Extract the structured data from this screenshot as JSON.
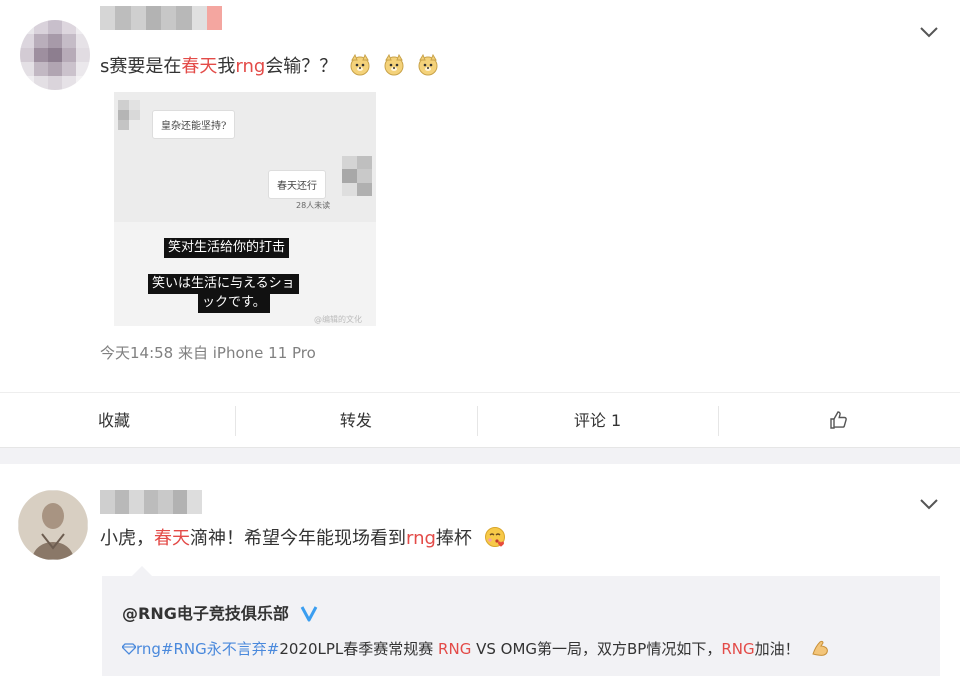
{
  "post": {
    "text_prefix": "s赛要是在",
    "highlight_1": "春天",
    "text_mid": "我",
    "highlight_2": "rng",
    "text_suffix": "会输？？",
    "emoji": [
      "doge-emoji",
      "doge-emoji",
      "doge-emoji"
    ],
    "image": {
      "bubble_left": "皇杂还能坚持?",
      "bubble_right": "春天还行",
      "read_count": "28人未读",
      "subtitle_1": "笑对生活给你的打击",
      "subtitle_2a": "笑いは生活に与えるショ",
      "subtitle_2b": "ックです。",
      "watermark": "@编辑的文化"
    },
    "meta": "今天14:58  来自 iPhone 11 Pro",
    "actions": {
      "favorite": "收藏",
      "repost": "转发",
      "comment": "评论 1"
    }
  },
  "reply": {
    "text_prefix": "小虎，",
    "highlight_1": "春天",
    "text_mid": "滴神！希望今年能现场看到",
    "highlight_2": "rng",
    "text_suffix": "捧杯",
    "quote": {
      "author": "@RNG电子竞技俱乐部",
      "topic_1": "rng",
      "topic_2": "#RNG永不言弃#",
      "body_mid": "2020LPL春季赛常规赛 ",
      "red_1": "RNG",
      "body_mid_2": " VS OMG第一局，双方BP情况如下，",
      "red_2": "RNG",
      "body_end": "加油！"
    }
  },
  "colors": {
    "highlight": "#eb7350",
    "red": "#e34b48",
    "link_blue": "#4a89dc",
    "verified_blue": "#3b9ef0",
    "meta_gray": "#808080"
  }
}
